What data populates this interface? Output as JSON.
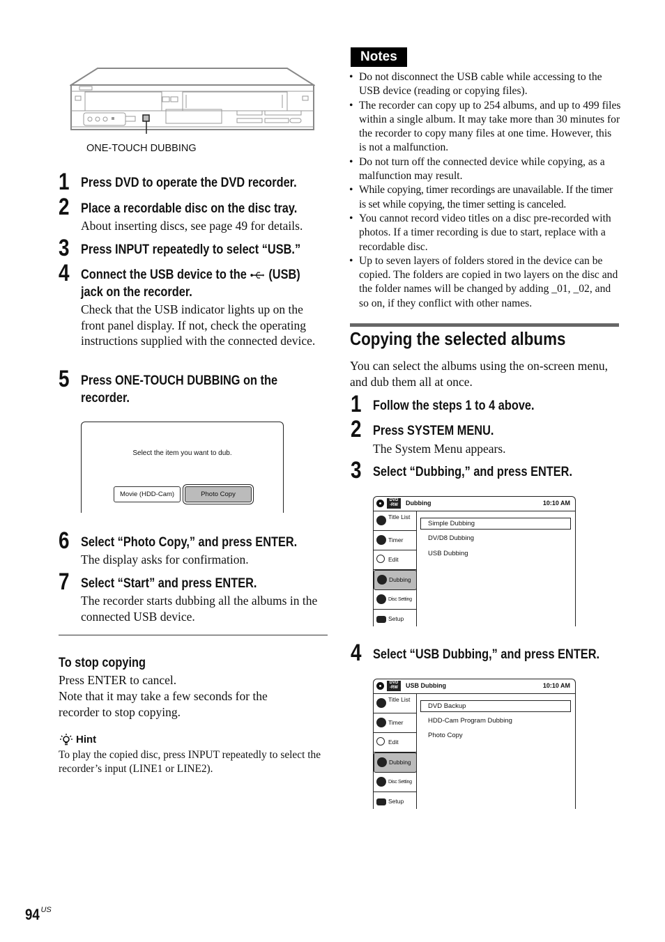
{
  "device_illustration": {
    "callout_label": "ONE-TOUCH DUBBING"
  },
  "left_steps": [
    {
      "num": "1",
      "title": "Press DVD to operate the DVD recorder.",
      "body": ""
    },
    {
      "num": "2",
      "title": "Place a recordable disc on the disc tray.",
      "body": "About inserting discs, see page 49 for details."
    },
    {
      "num": "3",
      "title": "Press INPUT repeatedly to select “USB.”",
      "body": ""
    },
    {
      "num": "4",
      "title_line1_a": "Connect the USB device to the",
      "usb_icon": "usb-icon",
      "title_line1_b": "(USB)",
      "title_line2": "jack on the recorder.",
      "body": "Check that the USB indicator lights up on the front panel display. If not, check the operating instructions supplied with the connected device."
    },
    {
      "num": "5",
      "title_line1": "Press ONE-TOUCH DUBBING on the",
      "title_line2": "recorder.",
      "body": ""
    },
    {
      "num": "6",
      "title": "Select “Photo Copy,” and press ENTER.",
      "body": "The display asks for confirmation."
    },
    {
      "num": "7",
      "title": "Select “Start” and press ENTER.",
      "body": "The recorder starts dubbing all the albums in the connected USB device."
    }
  ],
  "dub_dialog": {
    "prompt": "Select the item you want to dub.",
    "options": [
      "Movie (HDD-Cam)",
      "Photo Copy"
    ],
    "selected": "Photo Copy"
  },
  "stop_copying": {
    "heading": "To stop copying",
    "line1": "Press ENTER to cancel.",
    "line2": "Note that it may take a few seconds for the recorder to stop copying."
  },
  "hint": {
    "icon": "lightbulb-icon",
    "label": "Hint",
    "text": "To play the copied disc, press INPUT repeatedly to select the recorder’s input (LINE1 or LINE2)."
  },
  "notes": {
    "label": "Notes",
    "items": [
      "Do not disconnect the USB cable while accessing to the USB device (reading or copying files).",
      "The recorder can copy up to 254 albums, and up to 499 files within a single album. It may take more than 30 minutes for the recorder to copy many files at one time. However, this is not a malfunction.",
      "Do not turn off the connected device while copying, as a malfunction may result.",
      "While copying, timer recordings are unavailable. If the timer is set while copying, the timer setting is canceled.",
      "You cannot record video titles on a disc pre-recorded with photos. If a timer recording is due to start, replace with a recordable disc.",
      "Up to seven layers of folders stored in the device can be copied. The folders are copied in two layers on the disc and the folder names will be changed by adding _01, _02, and so on, if they conflict with other names."
    ]
  },
  "section": {
    "title": "Copying the selected albums",
    "intro": "You can select the albums using the on-screen menu, and dub them all at once."
  },
  "right_steps": [
    {
      "num": "1",
      "title": "Follow the steps 1 to 4 above.",
      "body": ""
    },
    {
      "num": "2",
      "title": "Press SYSTEM MENU.",
      "body": "The System Menu appears."
    },
    {
      "num": "3",
      "title": "Select “Dubbing,” and press ENTER.",
      "body": ""
    },
    {
      "num": "4",
      "title": "Select “USB Dubbing,” and press ENTER.",
      "body": ""
    }
  ],
  "osd_common": {
    "disc_badge": "DVD\n-RW",
    "time": "10:10 AM",
    "sidebar": [
      "Title List",
      "Timer",
      "Edit",
      "Dubbing",
      "Disc Setting",
      "Setup"
    ],
    "sidebar_selected": "Dubbing"
  },
  "osd_dubbing": {
    "title": "Dubbing",
    "options": [
      "Simple Dubbing",
      "DV/D8 Dubbing",
      "USB Dubbing"
    ],
    "selected": "Simple Dubbing"
  },
  "osd_usb_dubbing": {
    "title": "USB Dubbing",
    "options": [
      "DVD Backup",
      "HDD-Cam Program Dubbing",
      "Photo Copy"
    ],
    "selected": "DVD Backup"
  },
  "footer": {
    "page_number": "94",
    "page_suffix": "US"
  }
}
